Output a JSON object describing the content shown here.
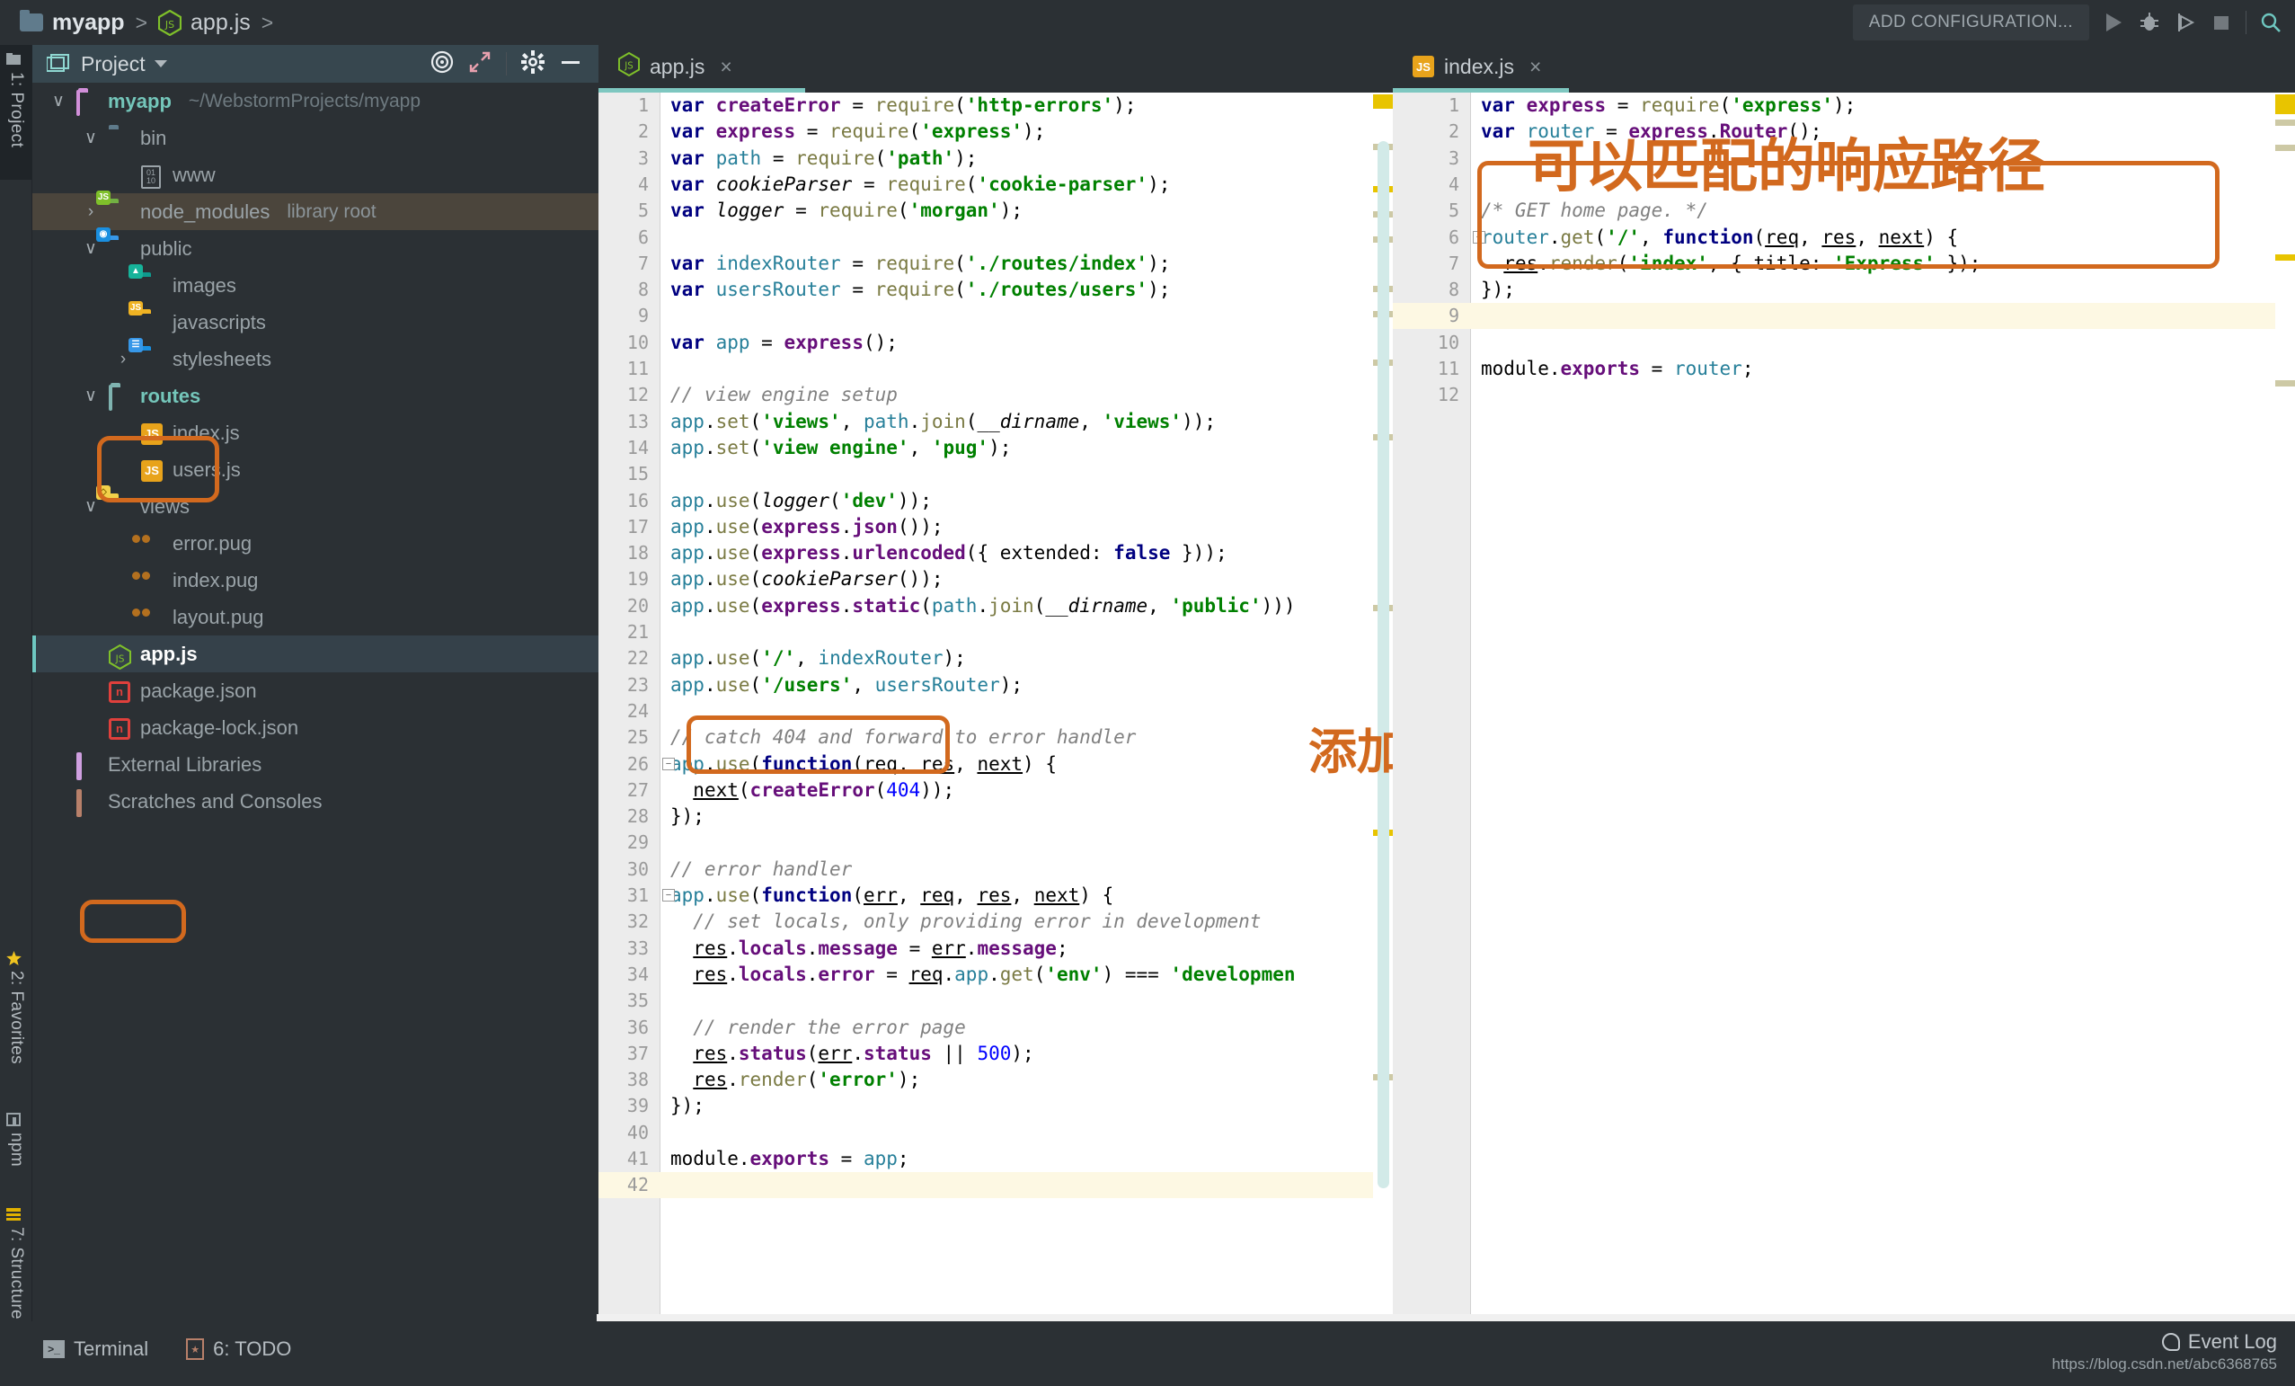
{
  "breadcrumb": {
    "project": "myapp",
    "separator": ">",
    "file": "app.js",
    "separator2": ">"
  },
  "toolbar": {
    "add_configuration": "ADD CONFIGURATION...",
    "icons": [
      "run-icon",
      "debug-icon",
      "run-coverage-icon",
      "stop-icon",
      "search-icon"
    ]
  },
  "rail": {
    "project_tab": "1: Project",
    "favorites_tab": "2: Favorites",
    "npm_tab": "npm",
    "structure_tab": "7: Structure"
  },
  "project_panel": {
    "title": "Project",
    "tree": [
      {
        "label": "myapp",
        "suffix": "~/WebstormProjects/myapp",
        "depth": 0,
        "arrow": "v",
        "icon": "folder-outline-purple",
        "style": "green"
      },
      {
        "label": "bin",
        "suffix": "",
        "depth": 1,
        "arrow": "v",
        "icon": "folder-plain",
        "style": ""
      },
      {
        "label": "www",
        "suffix": "",
        "depth": 2,
        "arrow": "",
        "icon": "binary-file",
        "style": ""
      },
      {
        "label": "node_modules",
        "suffix": "library root",
        "depth": 1,
        "arrow": ">",
        "icon": "folder-node",
        "style": "",
        "row": "highlight"
      },
      {
        "label": "public",
        "suffix": "",
        "depth": 1,
        "arrow": "v",
        "icon": "folder-web",
        "style": ""
      },
      {
        "label": "images",
        "suffix": "",
        "depth": 2,
        "arrow": "",
        "icon": "folder-images",
        "style": ""
      },
      {
        "label": "javascripts",
        "suffix": "",
        "depth": 2,
        "arrow": "",
        "icon": "folder-js",
        "style": ""
      },
      {
        "label": "stylesheets",
        "suffix": "",
        "depth": 2,
        "arrow": ">",
        "icon": "folder-css",
        "style": ""
      },
      {
        "label": "routes",
        "suffix": "",
        "depth": 1,
        "arrow": "v",
        "icon": "folder-outline-teal",
        "style": "green"
      },
      {
        "label": "index.js",
        "suffix": "",
        "depth": 2,
        "arrow": "",
        "icon": "js-file",
        "style": ""
      },
      {
        "label": "users.js",
        "suffix": "",
        "depth": 2,
        "arrow": "",
        "icon": "js-file",
        "style": ""
      },
      {
        "label": "views",
        "suffix": "",
        "depth": 1,
        "arrow": "v",
        "icon": "folder-views",
        "style": ""
      },
      {
        "label": "error.pug",
        "suffix": "",
        "depth": 2,
        "arrow": "",
        "icon": "pug-file",
        "style": ""
      },
      {
        "label": "index.pug",
        "suffix": "",
        "depth": 2,
        "arrow": "",
        "icon": "pug-file",
        "style": ""
      },
      {
        "label": "layout.pug",
        "suffix": "",
        "depth": 2,
        "arrow": "",
        "icon": "pug-file",
        "style": ""
      },
      {
        "label": "app.js",
        "suffix": "",
        "depth": 1,
        "arrow": "",
        "icon": "nodejs-file",
        "style": "white",
        "row": "selected"
      },
      {
        "label": "package.json",
        "suffix": "",
        "depth": 1,
        "arrow": "",
        "icon": "npm-file",
        "style": ""
      },
      {
        "label": "package-lock.json",
        "suffix": "",
        "depth": 1,
        "arrow": "",
        "icon": "npm-file",
        "style": ""
      },
      {
        "label": "External Libraries",
        "suffix": "",
        "depth": 0,
        "arrow": "",
        "icon": "external-libraries",
        "style": ""
      },
      {
        "label": "Scratches and Consoles",
        "suffix": "",
        "depth": 0,
        "arrow": "",
        "icon": "scratches",
        "style": ""
      }
    ]
  },
  "editor_left": {
    "tab_label": "app.js",
    "close_label": "×",
    "annotation": "添加路由",
    "total_lines": 42,
    "cursor_line": 42,
    "lines": [
      "var createError = require('http-errors');",
      "var express = require('express');",
      "var path = require('path');",
      "var cookieParser = require('cookie-parser');",
      "var logger = require('morgan');",
      "",
      "var indexRouter = require('./routes/index');",
      "var usersRouter = require('./routes/users');",
      "",
      "var app = express();",
      "",
      "// view engine setup",
      "app.set('views', path.join(__dirname, 'views'));",
      "app.set('view engine', 'pug');",
      "",
      "app.use(logger('dev'));",
      "app.use(express.json());",
      "app.use(express.urlencoded({ extended: false }));",
      "app.use(cookieParser());",
      "app.use(express.static(path.join(__dirname, 'public')))",
      "",
      "app.use('/', indexRouter);",
      "app.use('/users', usersRouter);",
      "",
      "// catch 404 and forward to error handler",
      "app.use(function(req, res, next) {",
      "  next(createError(404));",
      "});",
      "",
      "// error handler",
      "app.use(function(err, req, res, next) {",
      "  // set locals, only providing error in development",
      "  res.locals.message = err.message;",
      "  res.locals.error = req.app.get('env') === 'developmen",
      "",
      "  // render the error page",
      "  res.status(err.status || 500);",
      "  res.render('error');",
      "});",
      "",
      "module.exports = app;",
      ""
    ]
  },
  "editor_right": {
    "tab_label": "index.js",
    "close_label": "×",
    "annotation": "可以匹配的响应路径",
    "total_lines": 12,
    "cursor_line": 9,
    "lines": [
      "var express = require('express');",
      "var router = express.Router();",
      "",
      "",
      "/* GET home page. */",
      "router.get('/', function(req, res, next) {",
      "  res.render('index', { title: 'Express' });",
      "});",
      "",
      "",
      "module.exports = router;",
      ""
    ]
  },
  "statusbar": {
    "terminal": "Terminal",
    "todo": "6: TODO",
    "event_log": "Event Log",
    "watermark": "https://blog.csdn.net/abc6368765"
  },
  "colors": {
    "accent_orange": "#d2691e",
    "panel_bg": "#2b3034",
    "editor_bg": "#ffffff",
    "tab_underline": "#7ec7c0"
  }
}
